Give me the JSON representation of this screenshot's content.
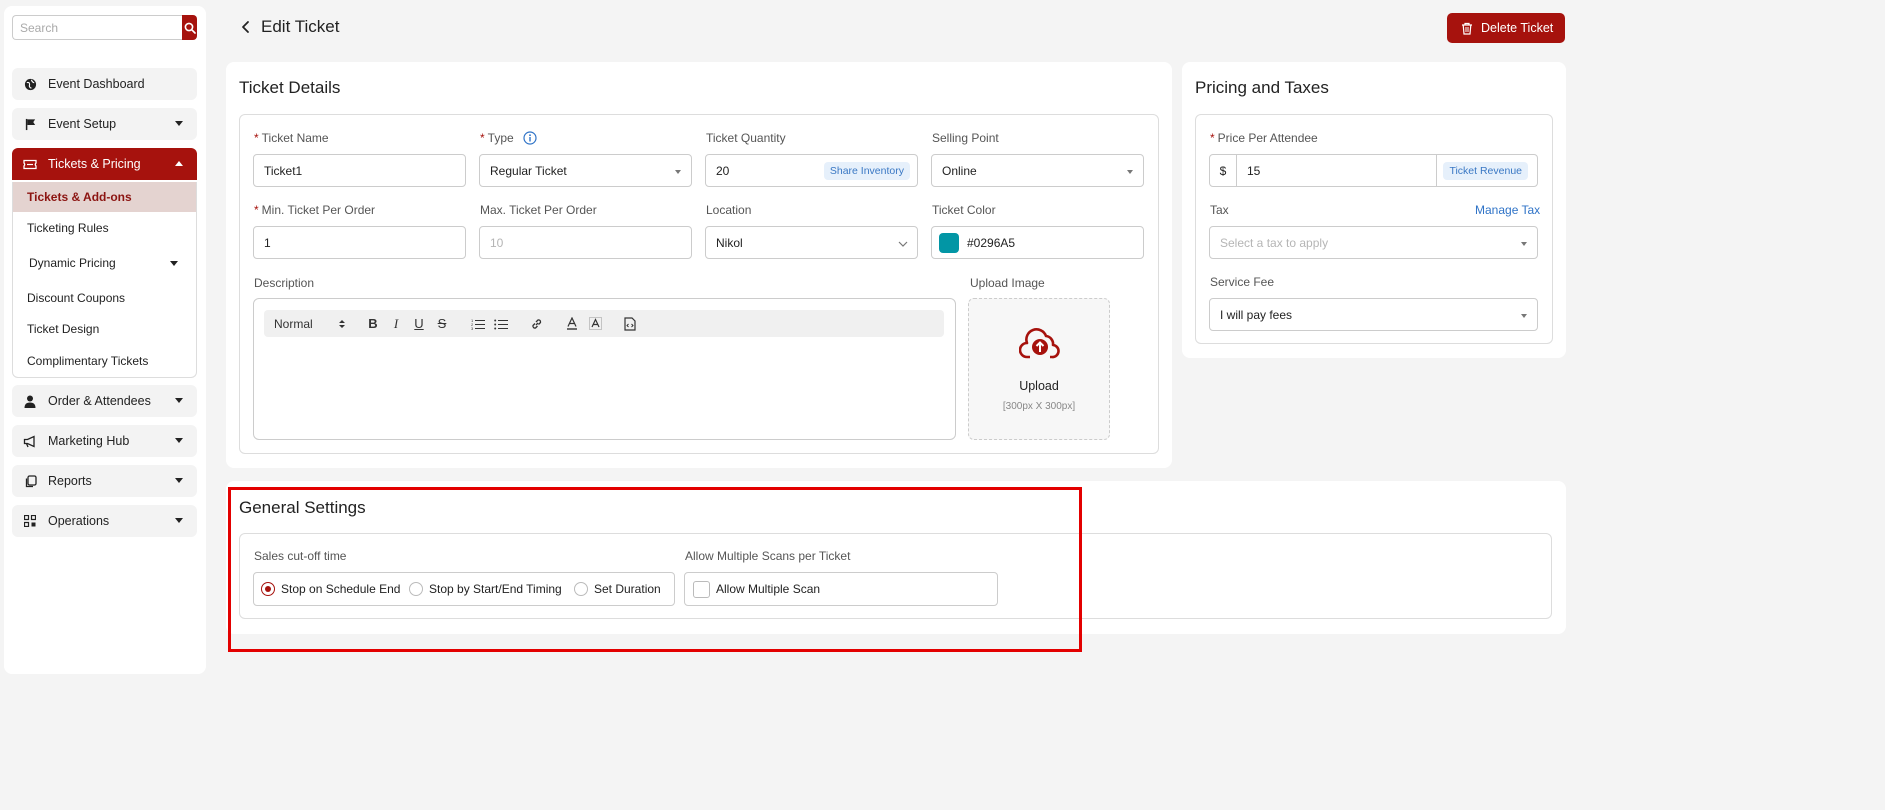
{
  "sidebar": {
    "search_placeholder": "Search",
    "items": [
      {
        "label": "Event Dashboard"
      },
      {
        "label": "Event Setup"
      },
      {
        "label": "Tickets & Pricing"
      },
      {
        "label": "Order & Attendees"
      },
      {
        "label": "Marketing Hub"
      },
      {
        "label": "Reports"
      },
      {
        "label": "Operations"
      }
    ],
    "submenu": [
      {
        "label": "Tickets & Add-ons",
        "selected": true
      },
      {
        "label": "Ticketing Rules"
      },
      {
        "label": "Dynamic Pricing"
      },
      {
        "label": "Discount Coupons"
      },
      {
        "label": "Ticket Design"
      },
      {
        "label": "Complimentary Tickets"
      }
    ]
  },
  "header": {
    "title": "Edit Ticket",
    "delete_label": "Delete Ticket"
  },
  "ticket_details": {
    "title": "Ticket Details",
    "ticket_name": {
      "label": "Ticket Name",
      "value": "Ticket1"
    },
    "type": {
      "label": "Type",
      "value": "Regular Ticket"
    },
    "ticket_quantity": {
      "label": "Ticket Quantity",
      "value": "20",
      "badge": "Share Inventory"
    },
    "selling_point": {
      "label": "Selling Point",
      "value": "Online"
    },
    "min_per_order": {
      "label": "Min. Ticket Per Order",
      "value": "1"
    },
    "max_per_order": {
      "label": "Max. Ticket Per Order",
      "placeholder": "10"
    },
    "location": {
      "label": "Location",
      "value": "Nikol"
    },
    "ticket_color": {
      "label": "Ticket Color",
      "value": "#0296A5"
    },
    "description": {
      "label": "Description",
      "format": "Normal"
    },
    "upload": {
      "label": "Upload Image",
      "button": "Upload",
      "hint": "[300px X 300px]"
    }
  },
  "pricing": {
    "title": "Pricing and Taxes",
    "price": {
      "label": "Price Per Attendee",
      "currency": "$",
      "value": "15",
      "badge": "Ticket Revenue"
    },
    "tax": {
      "label": "Tax",
      "link": "Manage Tax",
      "placeholder": "Select a tax to apply"
    },
    "service_fee": {
      "label": "Service Fee",
      "value": "I will pay fees"
    }
  },
  "general_settings": {
    "title": "General Settings",
    "cutoff": {
      "label": "Sales cut-off time",
      "options": [
        "Stop on Schedule End",
        "Stop by Start/End Timing",
        "Set Duration"
      ],
      "selected": "Stop on Schedule End"
    },
    "multiple_scans": {
      "label": "Allow Multiple Scans per Ticket",
      "option": "Allow Multiple Scan",
      "checked": false
    }
  },
  "colors": {
    "accent": "#a6120d",
    "ticket_color": "#0296A5",
    "highlight": "#e30000"
  }
}
